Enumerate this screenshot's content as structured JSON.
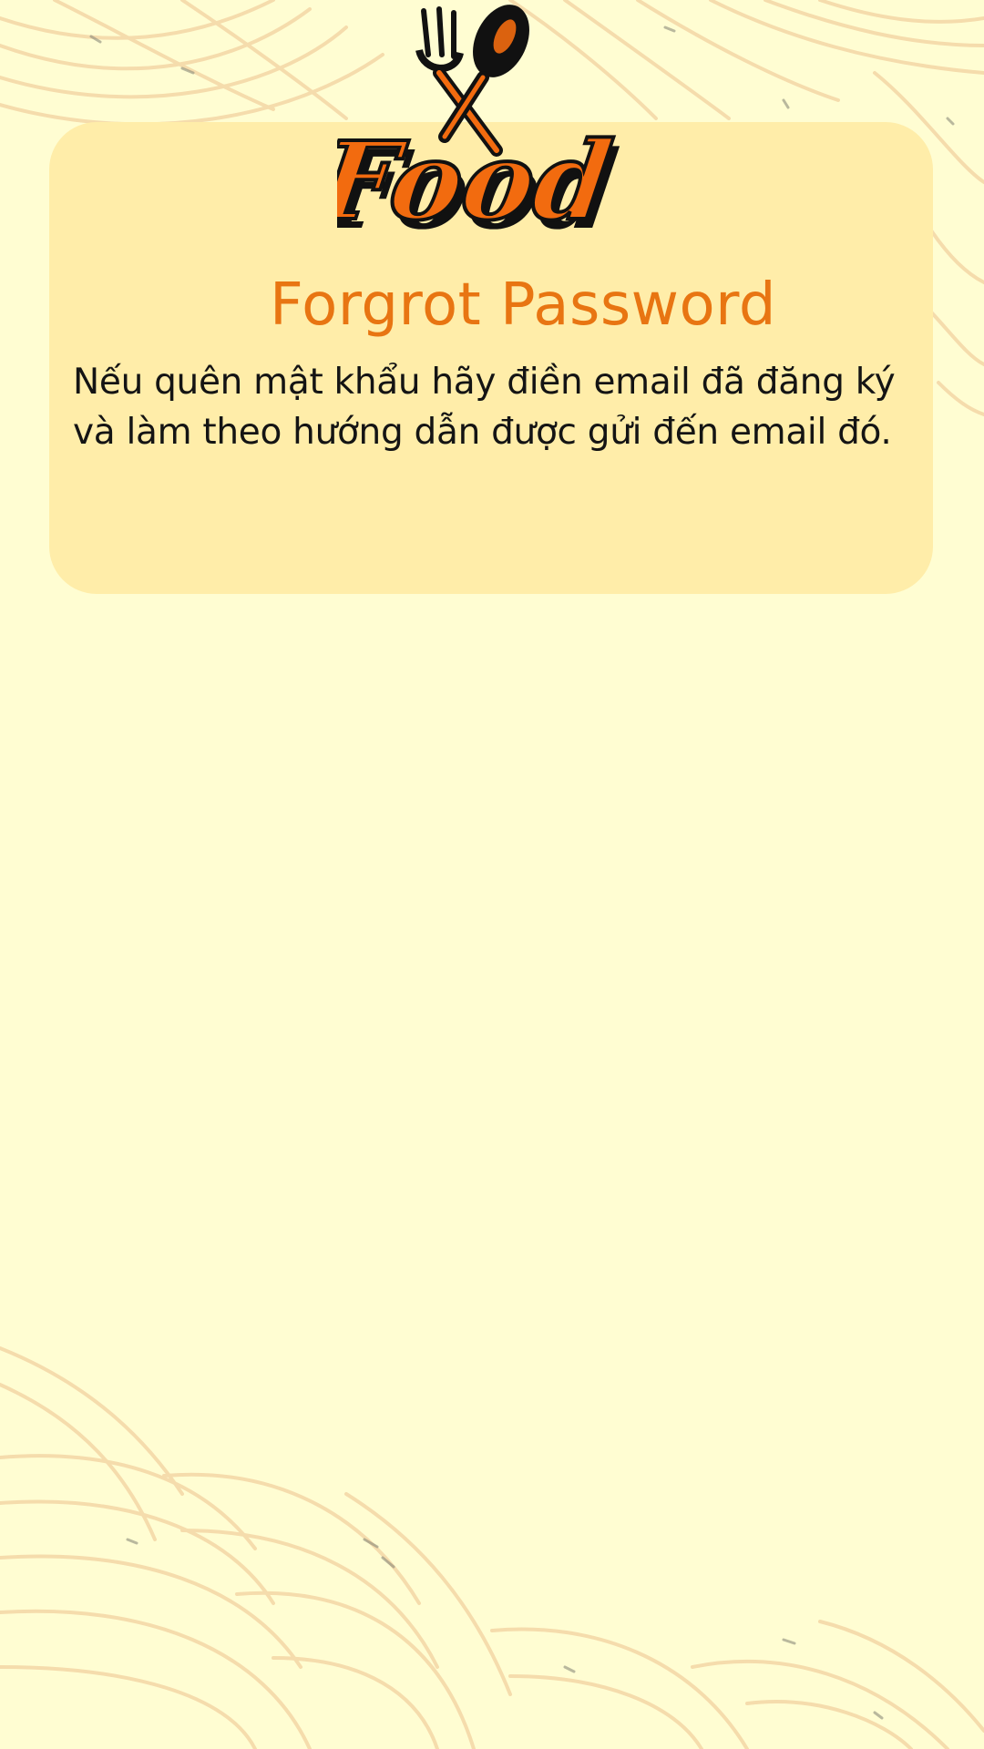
{
  "logo": {
    "text": "Food",
    "icons": [
      "fork-icon",
      "spoon-icon"
    ]
  },
  "title": "Forgrot Password",
  "description": "Nếu quên mật khẩu hãy điền email đã đăng ký và làm theo hướng dẫn được gửi đến email đó.",
  "colors": {
    "background": "#fffdd2",
    "card": "#ffeda9",
    "title": "#e87512",
    "logo_orange": "#f26b0f",
    "text": "#141414",
    "pattern_line": "#f4d9a8"
  }
}
